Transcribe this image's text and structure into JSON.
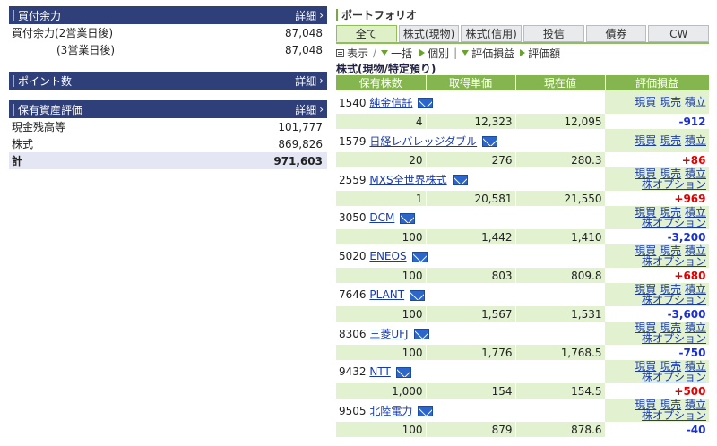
{
  "left": {
    "buying_power": {
      "title": "買付余力",
      "more": "詳細",
      "rows": [
        {
          "label": "買付余力(2営業日後)",
          "value": "87,048"
        },
        {
          "label": "(3営業日後)",
          "value": "87,048"
        }
      ]
    },
    "points": {
      "title": "ポイント数",
      "more": "詳細"
    },
    "assets": {
      "title": "保有資産評価",
      "more": "詳細",
      "rows": [
        {
          "label": "現金残高等",
          "value": "101,777"
        },
        {
          "label": "株式",
          "value": "869,826"
        }
      ],
      "total": {
        "label": "計",
        "value": "971,603"
      }
    }
  },
  "portfolio": {
    "title": "ポートフォリオ",
    "tabs": [
      "全て",
      "株式(現物)",
      "株式(信用)",
      "投信",
      "債券",
      "CW"
    ],
    "active_tab": "全て",
    "toolbar": {
      "display": "表示",
      "bulk": "一括",
      "individual": "個別",
      "pl": "評価損益",
      "amount": "評価額",
      "sep": "/",
      "bar": "|"
    },
    "section_title": "株式(現物/特定預り)",
    "columns": [
      "保有株数",
      "取得単価",
      "現在値",
      "評価損益"
    ],
    "links": {
      "buy": "現買",
      "sell": "現売",
      "accum": "積立",
      "option": "株オプション"
    },
    "holdings": [
      {
        "code": "1540",
        "name": "純金信託",
        "qty": "4",
        "cost": "12,323",
        "price": "12,095",
        "pl": "-912",
        "sign": "neg",
        "option": false
      },
      {
        "code": "1579",
        "name": "日経レバレッジダブル",
        "qty": "20",
        "cost": "276",
        "price": "280.3",
        "pl": "+86",
        "sign": "pos",
        "option": false
      },
      {
        "code": "2559",
        "name": "MXS全世界株式",
        "qty": "1",
        "cost": "20,581",
        "price": "21,550",
        "pl": "+969",
        "sign": "pos",
        "option": true
      },
      {
        "code": "3050",
        "name": "DCM",
        "qty": "100",
        "cost": "1,442",
        "price": "1,410",
        "pl": "-3,200",
        "sign": "neg",
        "option": true
      },
      {
        "code": "5020",
        "name": "ENEOS",
        "qty": "100",
        "cost": "803",
        "price": "809.8",
        "pl": "+680",
        "sign": "pos",
        "option": true
      },
      {
        "code": "7646",
        "name": "PLANT",
        "qty": "100",
        "cost": "1,567",
        "price": "1,531",
        "pl": "-3,600",
        "sign": "neg",
        "option": true
      },
      {
        "code": "8306",
        "name": "三菱UFJ",
        "qty": "100",
        "cost": "1,776",
        "price": "1,768.5",
        "pl": "-750",
        "sign": "neg",
        "option": true
      },
      {
        "code": "9432",
        "name": "NTT",
        "qty": "1,000",
        "cost": "154",
        "price": "154.5",
        "pl": "+500",
        "sign": "pos",
        "option": true
      },
      {
        "code": "9505",
        "name": "北陸電力",
        "qty": "100",
        "cost": "879",
        "price": "878.6",
        "pl": "-40",
        "sign": "neg",
        "option": true
      }
    ]
  }
}
